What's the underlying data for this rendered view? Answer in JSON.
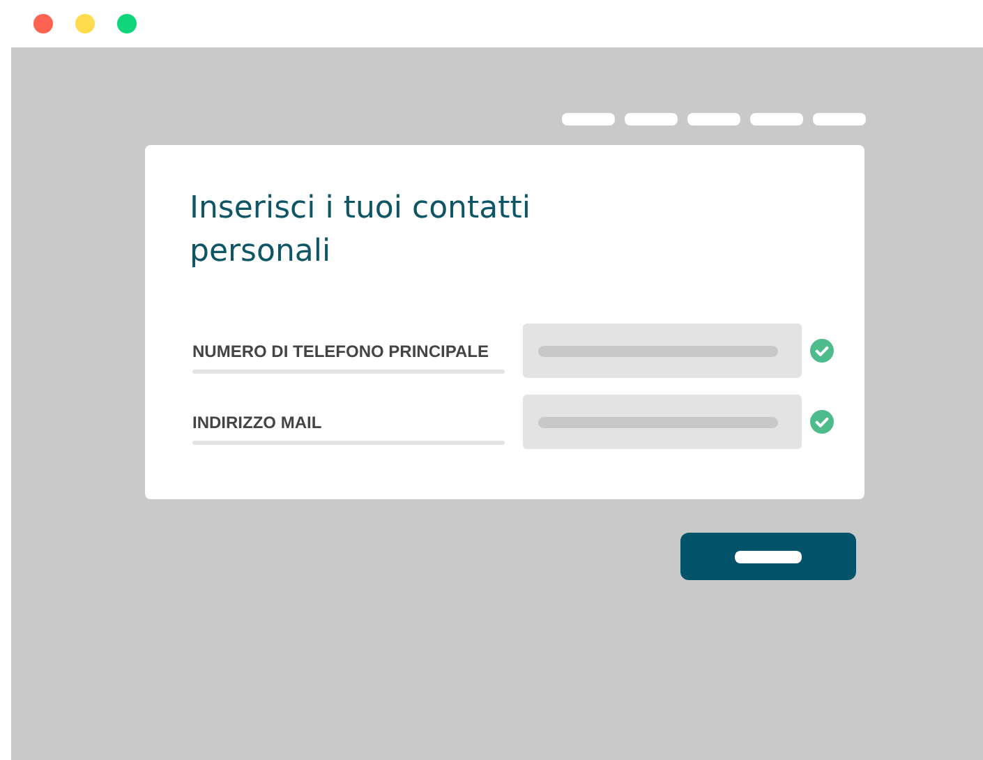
{
  "form": {
    "title": "Inserisci i tuoi contatti personali",
    "fields": [
      {
        "label": "NUMERO DI TELEFONO PRINCIPALE",
        "valid": true
      },
      {
        "label": "INDIRIZZO MAIL",
        "valid": true
      }
    ]
  }
}
